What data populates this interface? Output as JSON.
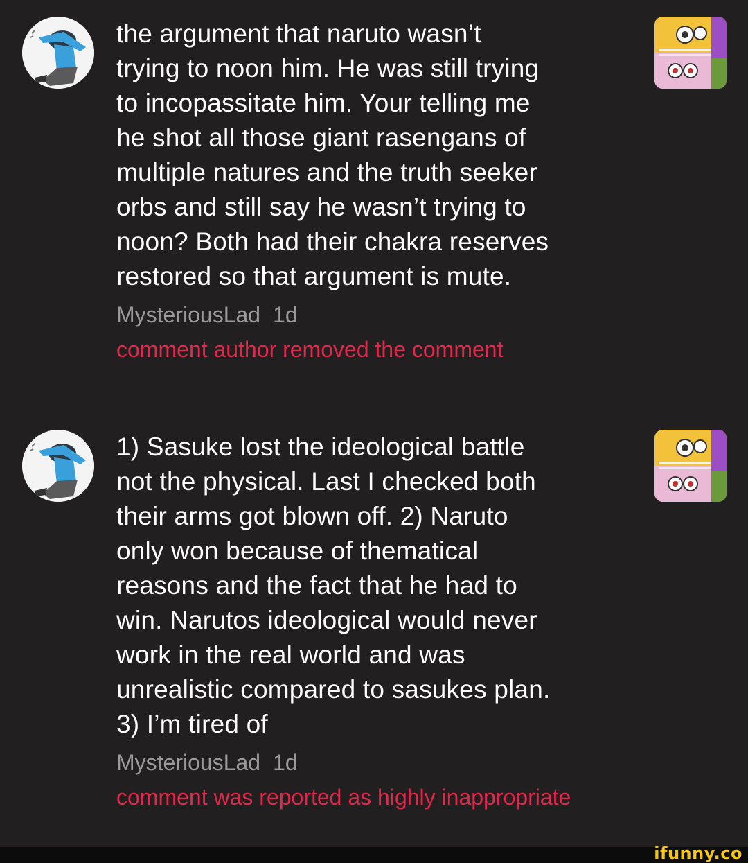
{
  "comments": [
    {
      "avatar_icon": "user-avatar-dab-icon",
      "thumbnail_icon": "meme-thumbnail-icon",
      "text": "the argument that naruto wasn’t\ntrying to noon him. He was still trying\nto incopassitate him. Your telling me\nhe shot all those giant rasengans of\nmultiple natures and the truth seeker\norbs and still say he wasn’t trying to\nnoon? Both had their chakra reserves\nrestored so that argument is mute.",
      "author": "MysteriousLad",
      "time": "1d",
      "status": "comment author removed the comment"
    },
    {
      "avatar_icon": "user-avatar-dab-icon",
      "thumbnail_icon": "meme-thumbnail-icon",
      "text": "1) Sasuke lost the ideological battle\nnot the physical. Last I checked both\ntheir arms got blown off. 2) Naruto\nonly won because of thematical\nreasons and the fact that he had to\nwin. Narutos ideological would never\nwork in the real world and was\nunrealistic compared to sasukes plan.\n3) I’m tired of",
      "author": "MysteriousLad",
      "time": "1d",
      "status": "comment was reported as highly inappropriate"
    }
  ],
  "watermark": "ifunny.co",
  "colors": {
    "background": "#211f20",
    "text": "#ffffff",
    "meta": "#9a9a9a",
    "status": "#e0284a",
    "watermark": "#f5c518"
  }
}
